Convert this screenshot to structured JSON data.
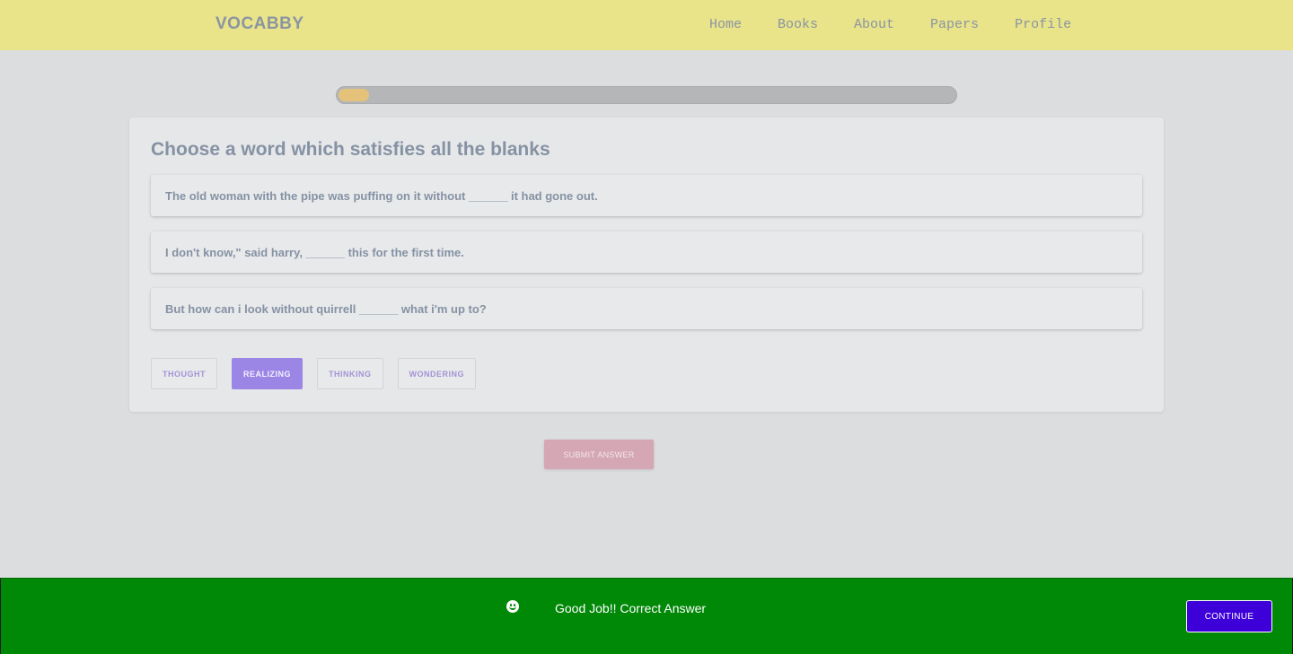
{
  "header": {
    "brand": "VOCABBY",
    "nav": [
      "Home",
      "Books",
      "About",
      "Papers",
      "Profile"
    ]
  },
  "progress": {
    "fraction": 0.05,
    "fill_color": "#e5c27a"
  },
  "question": {
    "title": "Choose a word which satisfies all the blanks",
    "sentences": [
      "The old woman with the pipe was puffing on it without ______ it had gone out.",
      "I don't know,\" said harry, ______ this for the first time.",
      "But how can i look without quirrell ______ what i'm up to?"
    ],
    "options": [
      "THOUGHT",
      "REALIZING",
      "THINKING",
      "WONDERING"
    ],
    "selected_index": 1
  },
  "submit_label": "SUBMIT ANSWER",
  "feedback": {
    "icon": "smile-icon",
    "message": "Good Job!! Correct Answer",
    "continue_label": "CONTINUE",
    "color": "#008807"
  }
}
